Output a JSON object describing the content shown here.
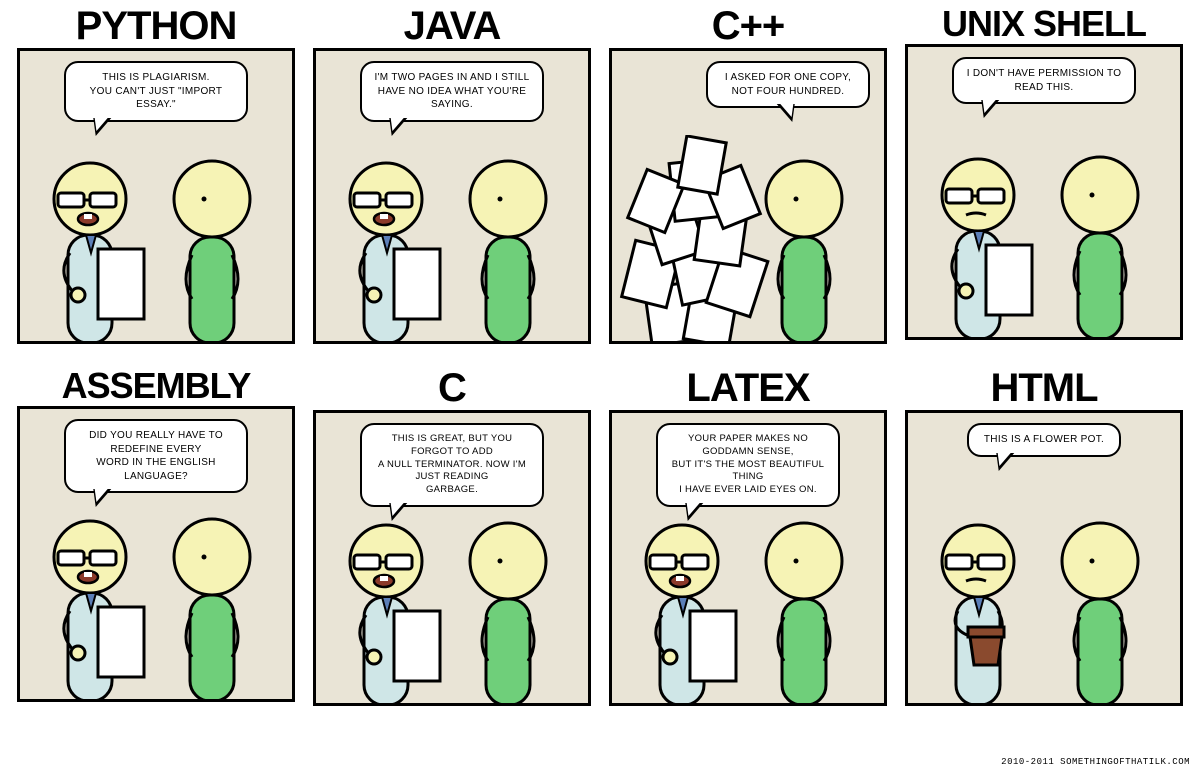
{
  "panels": [
    {
      "title": "PYTHON",
      "caption": "THIS IS PLAGIARISM.\nYOU CAN'T JUST \"IMPORT ESSAY.\""
    },
    {
      "title": "JAVA",
      "caption": "I'M TWO PAGES IN AND I STILL\nHAVE NO IDEA WHAT YOU'RE SAYING."
    },
    {
      "title": "C++",
      "caption": "I ASKED FOR ONE COPY,\nNOT FOUR HUNDRED."
    },
    {
      "title": "UNIX SHELL",
      "caption": "I DON'T HAVE PERMISSION TO\nREAD THIS."
    },
    {
      "title": "ASSEMBLY",
      "caption": "DID YOU REALLY HAVE TO REDEFINE EVERY\nWORD IN THE ENGLISH LANGUAGE?"
    },
    {
      "title": "C",
      "caption": "THIS IS GREAT, BUT YOU FORGOT TO ADD\nA NULL TERMINATOR. NOW I'M JUST READING\nGARBAGE."
    },
    {
      "title": "LATEX",
      "caption": "YOUR PAPER MAKES NO GODDAMN SENSE,\nBUT IT'S THE MOST BEAUTIFUL THING\nI HAVE EVER LAID EYES ON."
    },
    {
      "title": "HTML",
      "caption": "THIS IS A FLOWER POT."
    }
  ],
  "attribution": "2010-2011 SOMETHINGOFTHATILK.COM"
}
